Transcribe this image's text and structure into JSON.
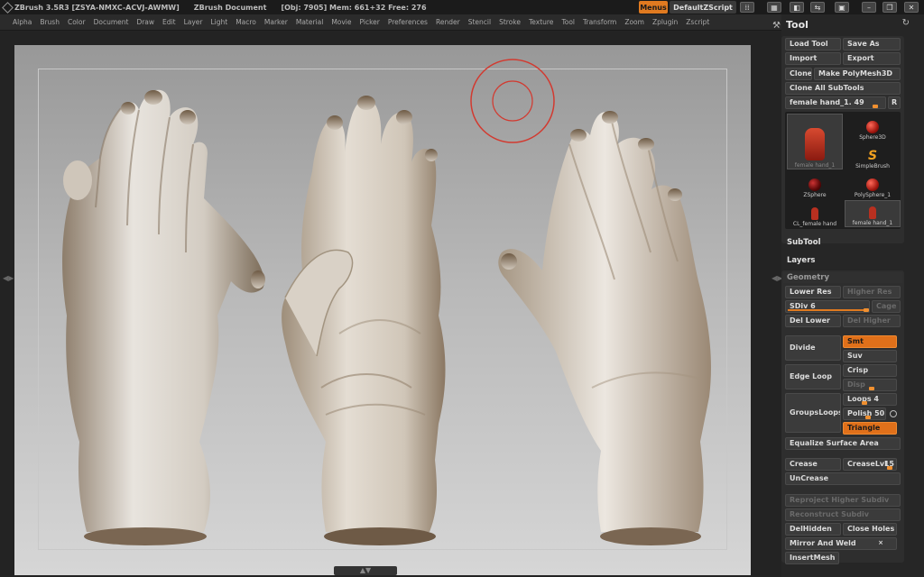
{
  "titlebar": {
    "app": "ZBrush 3.5R3 [ZSYA-NMXC-ACVJ-AWMW]",
    "document": "ZBrush Document",
    "stats": "[Obj: 7905] Mem: 661+32 Free: 276",
    "menus_label": "Menus",
    "script_label": "DefaultZScript"
  },
  "menubar": [
    "Alpha",
    "Brush",
    "Color",
    "Document",
    "Draw",
    "Edit",
    "Layer",
    "Light",
    "Macro",
    "Marker",
    "Material",
    "Movie",
    "Picker",
    "Preferences",
    "Render",
    "Stencil",
    "Stroke",
    "Texture",
    "Tool",
    "Transform",
    "Zoom",
    "Zplugin",
    "Zscript"
  ],
  "tray": {
    "title": "Tool",
    "load_tool": "Load Tool",
    "save_as": "Save As",
    "import": "Import",
    "export": "Export",
    "clone": "Clone",
    "make_polymesh": "Make PolyMesh3D",
    "clone_all": "Clone All SubTools",
    "current_tool": "female hand_1. 49",
    "r_button": "R",
    "thumbs": [
      {
        "label": "female hand_1",
        "icon": "hand-thumbnail-large"
      },
      {
        "label": "Sphere3D",
        "icon": "sphere-icon"
      },
      {
        "label": "SimpleBrush",
        "icon": "simplebrush-icon"
      },
      {
        "label": "ZSphere",
        "icon": "zsphere-icon"
      },
      {
        "label": "PolySphere_1",
        "icon": "polysphere-icon"
      },
      {
        "label": "CL_female hand",
        "icon": "hand-icon"
      },
      {
        "label": "female hand_1",
        "icon": "hand-icon"
      }
    ],
    "subtool": "SubTool",
    "layers": "Layers",
    "geometry": {
      "header": "Geometry",
      "lower_res": "Lower Res",
      "higher_res": "Higher Res",
      "sdiv": "SDiv 6",
      "sdiv_value": 1.0,
      "cage": "Cage",
      "del_lower": "Del Lower",
      "del_higher": "Del Higher",
      "divide": "Divide",
      "smt": "Smt",
      "suv": "Suv",
      "edge_loop": "Edge Loop",
      "crisp": "Crisp",
      "disp": "Disp",
      "groups_loops": "GroupsLoops",
      "loops": "Loops 4",
      "polish": "Polish 50",
      "triangle": "Triangle",
      "equalize": "Equalize Surface Area",
      "crease": "Crease",
      "creaselvl": "CreaseLvl",
      "creaselvl_value": "15",
      "uncrease": "UnCrease",
      "reproject": "Reproject Higher Subdiv",
      "reconstruct": "Reconstruct Subdiv",
      "delhidden": "DelHidden",
      "close_holes": "Close Holes",
      "mirror_weld": "Mirror And Weld",
      "insertmesh": "InsertMesh"
    }
  }
}
